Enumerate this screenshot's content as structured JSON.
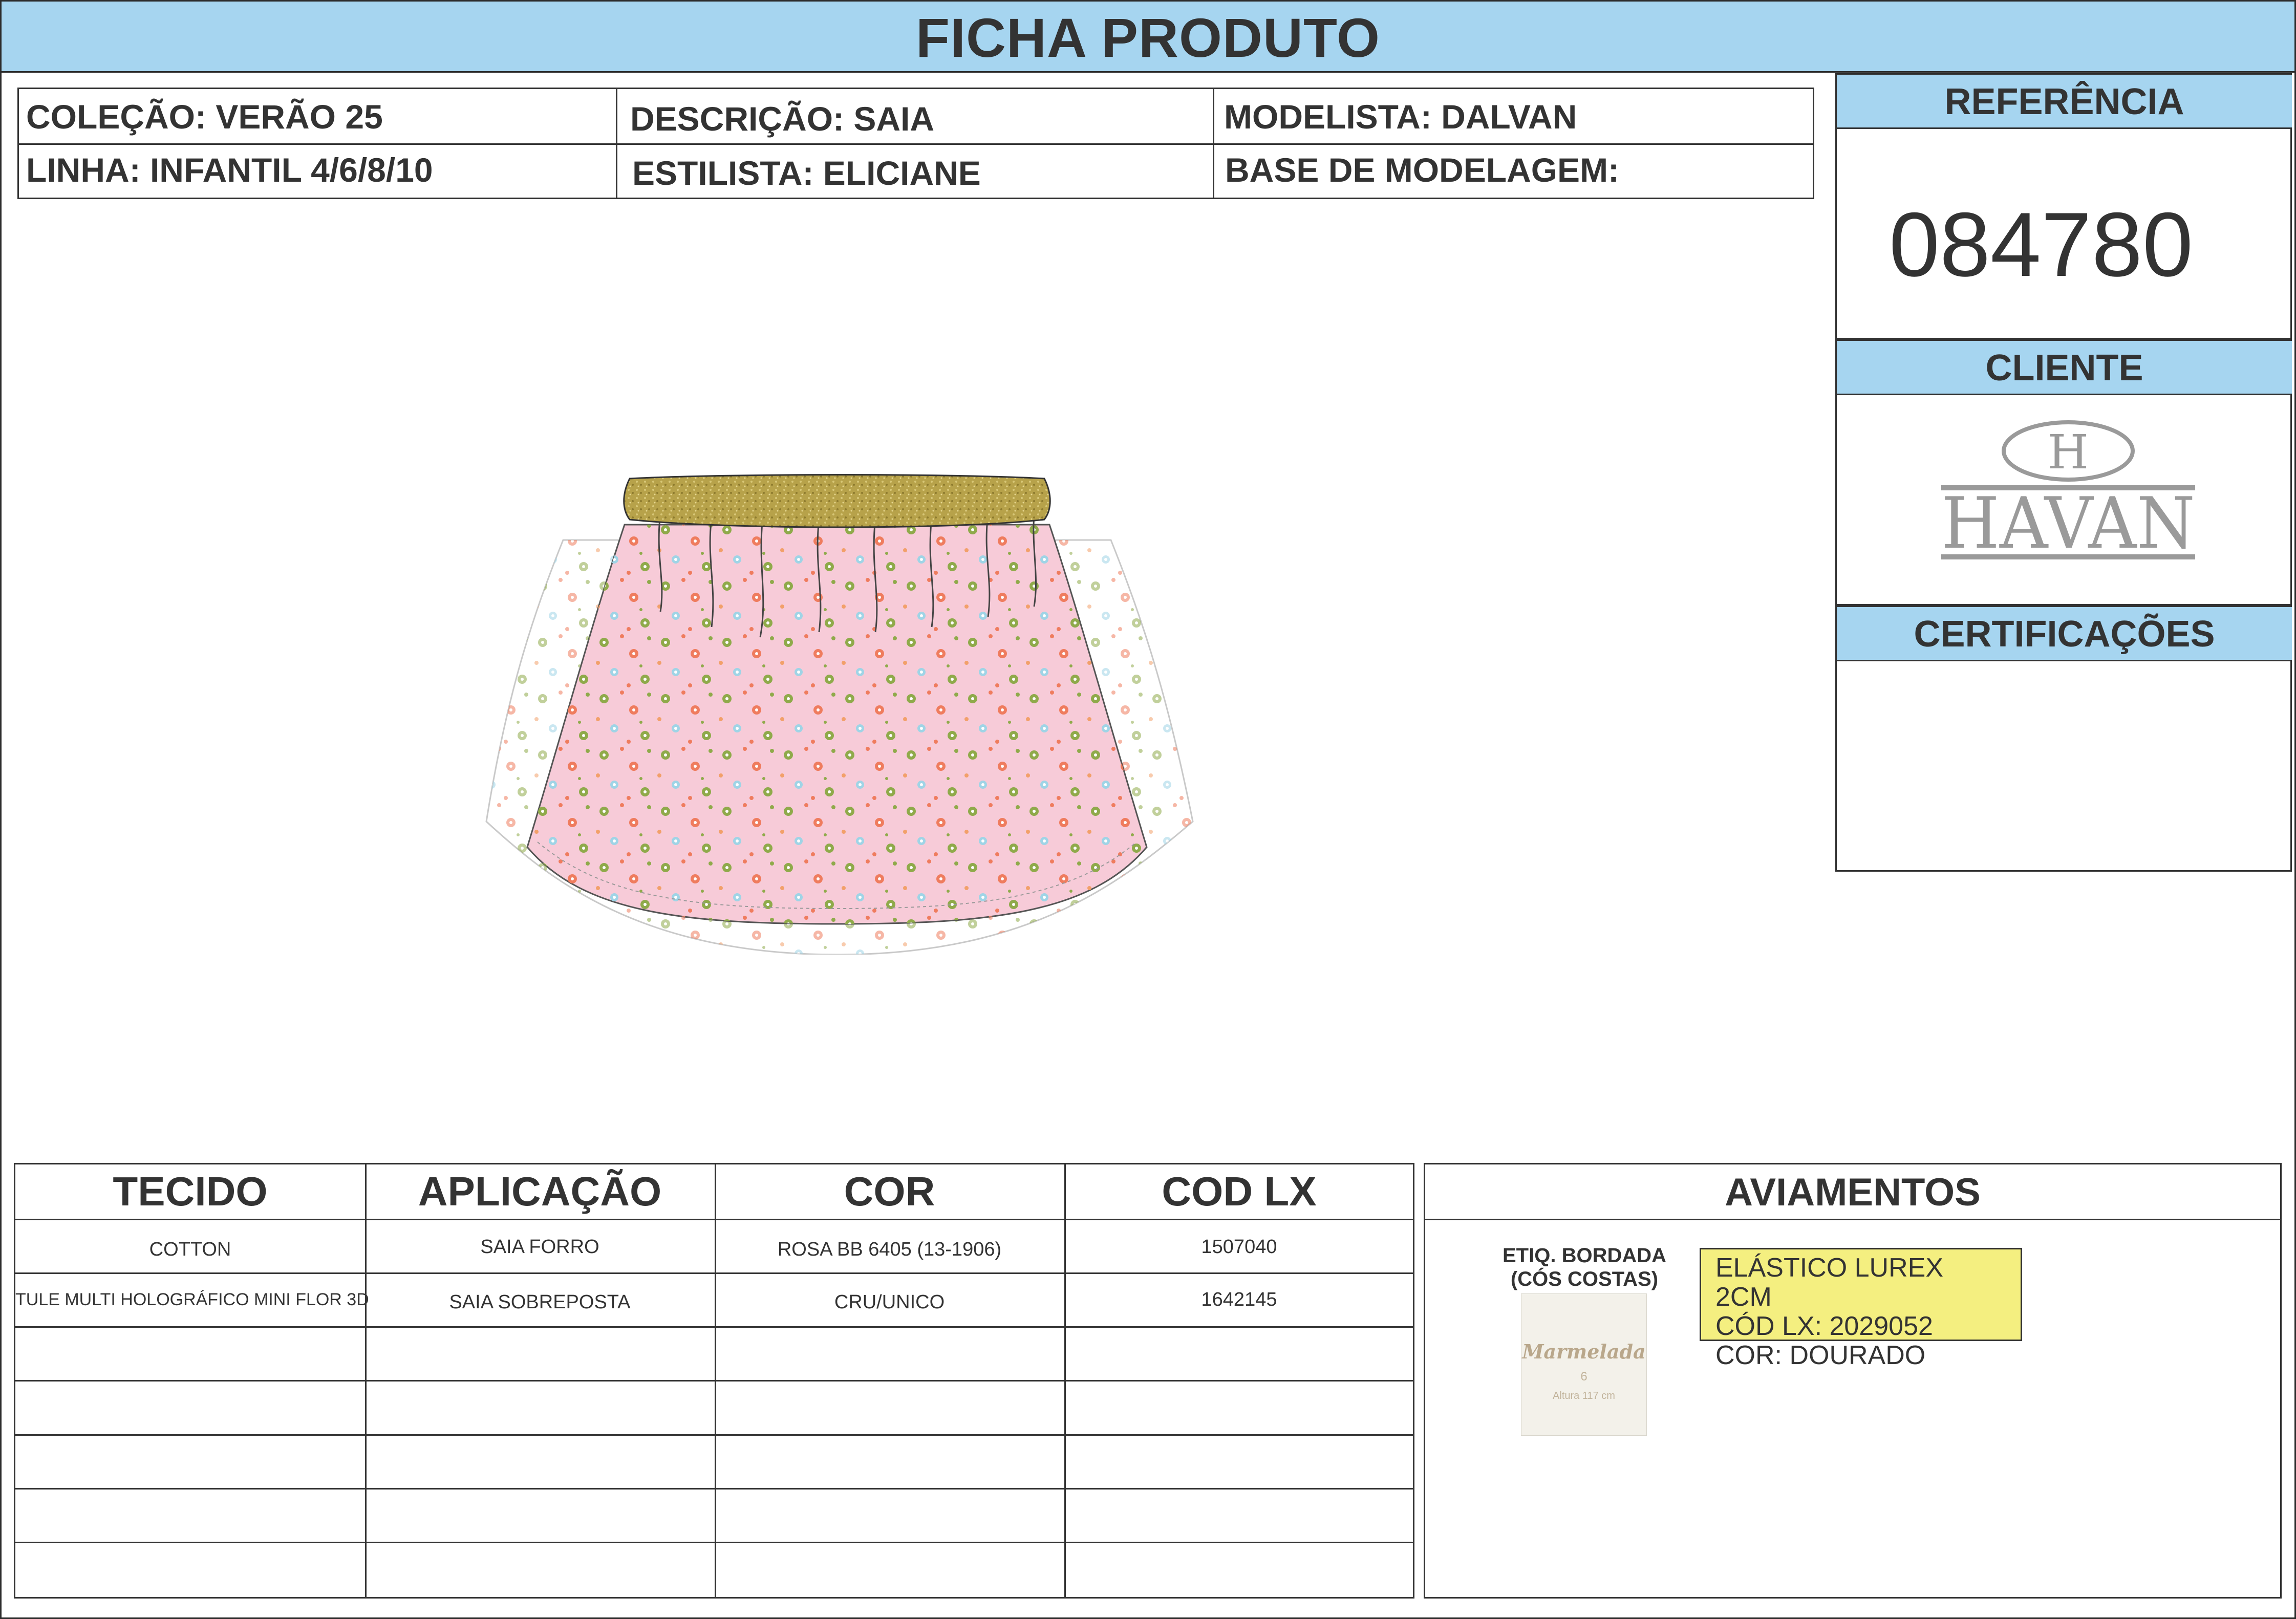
{
  "header": {
    "title": "FICHA PRODUTO"
  },
  "info": {
    "colecao": "COLEÇÃO: VERÃO 25",
    "descricao": "DESCRIÇÃO: SAIA",
    "modelista": "MODELISTA: DALVAN",
    "linha": "LINHA: INFANTIL 4/6/8/10",
    "estilista": "ESTILISTA: ELICIANE",
    "base_modelagem": "BASE DE MODELAGEM:"
  },
  "panel": {
    "referencia_title": "REFERÊNCIA",
    "referencia": "084780",
    "cliente_title": "CLIENTE",
    "cliente_logo_letter": "H",
    "cliente_logo_text": "HAVAN",
    "certificacoes_title": "CERTIFICAÇÕES"
  },
  "materials": {
    "headers": [
      "TECIDO",
      "APLICAÇÃO",
      "COR",
      "COD LX"
    ],
    "rows": [
      [
        "COTTON",
        "SAIA FORRO",
        "ROSA BB 6405 (13-1906)",
        "1507040"
      ],
      [
        "TULE MULTI HOLOGRÁFICO MINI FLOR 3D",
        "SAIA SOBREPOSTA",
        "CRU/UNICO",
        "1642145"
      ]
    ]
  },
  "aviamentos": {
    "title": "AVIAMENTOS",
    "etiqueta_label_1": "ETIQ. BORDADA",
    "etiqueta_label_2": "(CÓS COSTAS)",
    "etiqueta_brand": "Marmelada",
    "etiqueta_size": "6",
    "etiqueta_height": "Altura 117 cm",
    "note_line_1": "ELÁSTICO LUREX 2CM",
    "note_line_2": "CÓD LX: 2029052",
    "note_line_3": "COR: DOURADO"
  },
  "colors": {
    "header_blue": "#a6d5f0",
    "skirt_pink": "#f7cbd8",
    "waistband_gold": "#b7a24a",
    "note_yellow": "#f4ef80"
  },
  "icons": [
    "havan-logo",
    "skirt-illustration",
    "embroidered-label"
  ]
}
